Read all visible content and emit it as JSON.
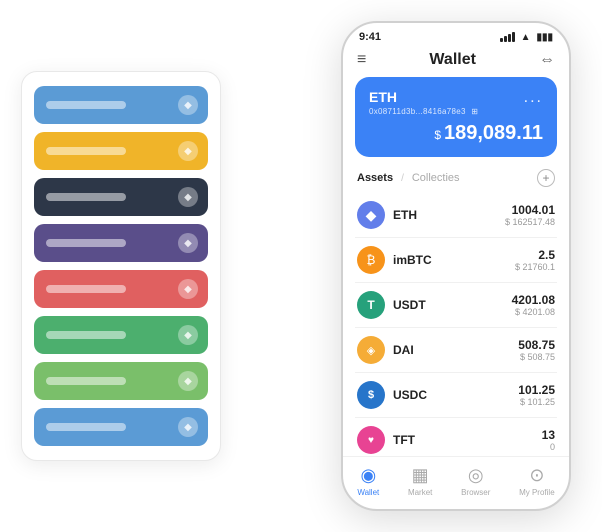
{
  "cardStack": {
    "items": [
      {
        "color": "card-blue",
        "label": "",
        "icon": "◆"
      },
      {
        "color": "card-yellow",
        "label": "",
        "icon": "◆"
      },
      {
        "color": "card-dark",
        "label": "",
        "icon": "◆"
      },
      {
        "color": "card-purple",
        "label": "",
        "icon": "◆"
      },
      {
        "color": "card-red",
        "label": "",
        "icon": "◆"
      },
      {
        "color": "card-green",
        "label": "",
        "icon": "◆"
      },
      {
        "color": "card-lightgreen",
        "label": "",
        "icon": "◆"
      },
      {
        "color": "card-bluelight",
        "label": "",
        "icon": "◆"
      }
    ]
  },
  "statusBar": {
    "time": "9:41",
    "battery": "■"
  },
  "topNav": {
    "menuIcon": "≡",
    "title": "Wallet",
    "expandIcon": "⇔"
  },
  "walletCard": {
    "tokenName": "ETH",
    "address": "0x08711d3b...8416a78e3",
    "addressSuffix": "⊞",
    "moreIcon": "...",
    "balanceSymbol": "$",
    "balance": "189,089.11"
  },
  "assetsTabs": {
    "activeTab": "Assets",
    "separator": "/",
    "inactiveTab": "Collecties",
    "addLabel": "+"
  },
  "assets": [
    {
      "name": "ETH",
      "iconLabel": "◆",
      "iconClass": "icon-eth",
      "amount": "1004.01",
      "usdAmount": "$ 162517.48"
    },
    {
      "name": "imBTC",
      "iconLabel": "₿",
      "iconClass": "icon-imbtc",
      "amount": "2.5",
      "usdAmount": "$ 21760.1"
    },
    {
      "name": "USDT",
      "iconLabel": "T",
      "iconClass": "icon-usdt",
      "amount": "4201.08",
      "usdAmount": "$ 4201.08"
    },
    {
      "name": "DAI",
      "iconLabel": "◈",
      "iconClass": "icon-dai",
      "amount": "508.75",
      "usdAmount": "$ 508.75"
    },
    {
      "name": "USDC",
      "iconLabel": "$",
      "iconClass": "icon-usdc",
      "amount": "101.25",
      "usdAmount": "$ 101.25"
    },
    {
      "name": "TFT",
      "iconLabel": "♥",
      "iconClass": "icon-tft",
      "amount": "13",
      "usdAmount": "0"
    }
  ],
  "bottomNav": [
    {
      "label": "Wallet",
      "icon": "◉",
      "active": true
    },
    {
      "label": "Market",
      "icon": "📊",
      "active": false
    },
    {
      "label": "Browser",
      "icon": "👤",
      "active": false
    },
    {
      "label": "My Profile",
      "icon": "👤",
      "active": false
    }
  ]
}
